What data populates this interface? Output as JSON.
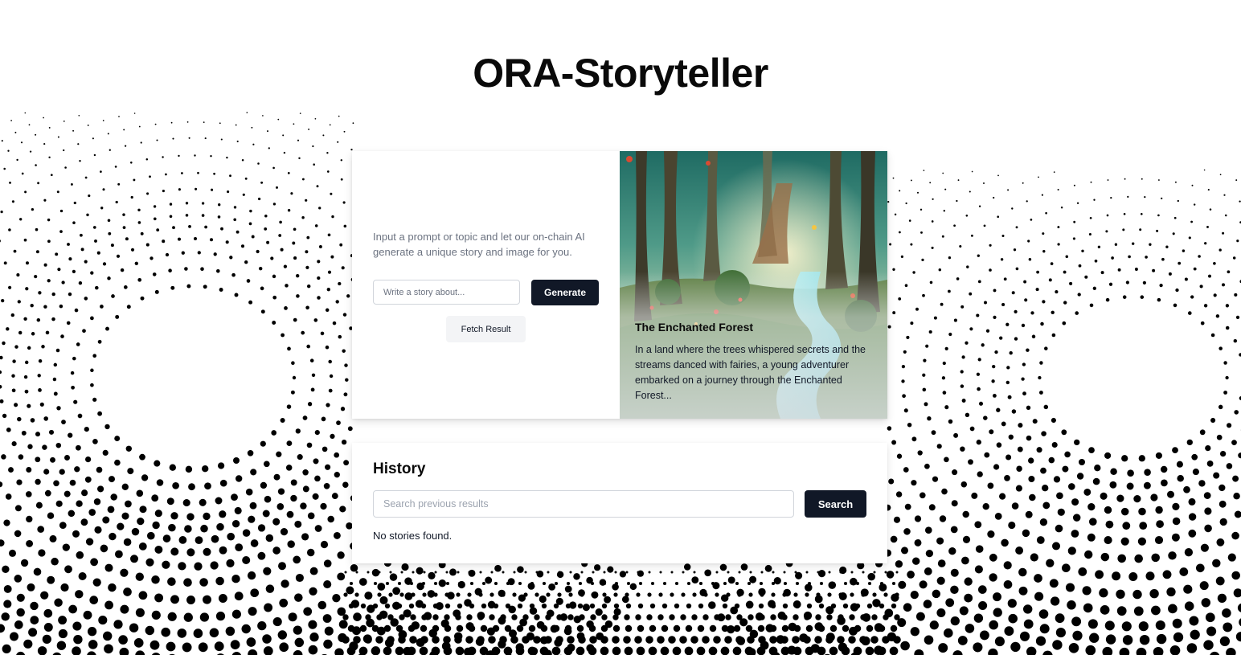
{
  "app": {
    "title": "ORA-Storyteller"
  },
  "generator": {
    "intro": "Input a prompt or topic and let our on-chain AI generate a unique story and image for you.",
    "prompt_placeholder": "Write a story about...",
    "generate_label": "Generate",
    "fetch_label": "Fetch Result"
  },
  "story": {
    "title": "The Enchanted Forest",
    "excerpt": "In a land where the trees whispered secrets and the streams danced with fairies, a young adventurer embarked on a journey through the Enchanted Forest...",
    "image_icon": "forest-illustration"
  },
  "history": {
    "heading": "History",
    "search_placeholder": "Search previous results",
    "search_label": "Search",
    "empty_message": "No stories found."
  },
  "colors": {
    "primary_button": "#111827",
    "secondary_button": "#f3f4f6",
    "muted_text": "#6b7280",
    "background": "#ffffff"
  }
}
